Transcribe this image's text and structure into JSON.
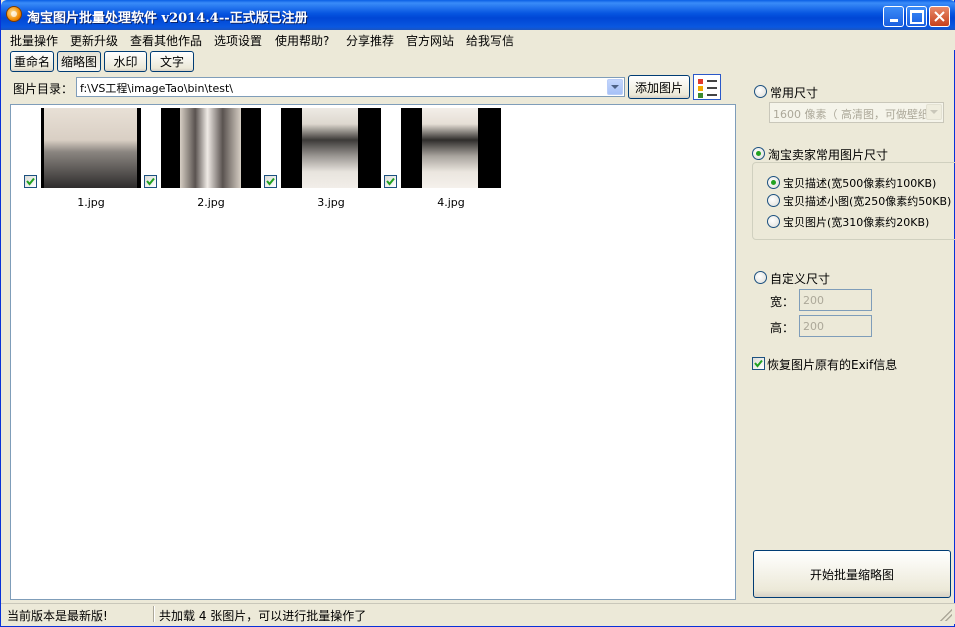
{
  "window": {
    "title": "淘宝图片批量处理软件  v2014.4--正式版已注册"
  },
  "menu": [
    "批量操作",
    "更新升级",
    "查看其他作品",
    "选项设置",
    "使用帮助?",
    "分享推荐",
    "官方网站",
    "给我写信"
  ],
  "toolbar": {
    "tabs": [
      "重命名",
      "缩略图",
      "水印",
      "文字"
    ],
    "active_tab": "缩略图"
  },
  "directory": {
    "label": "图片目录：",
    "path": "f:\\VS工程\\imageTao\\bin\\test\\",
    "add_button": "添加图片"
  },
  "thumbnails": [
    {
      "file": "1.jpg",
      "checked": true
    },
    {
      "file": "2.jpg",
      "checked": true
    },
    {
      "file": "3.jpg",
      "checked": true
    },
    {
      "file": "4.jpg",
      "checked": true
    }
  ],
  "options": {
    "common_size": {
      "label": "常用尺寸",
      "selected": false,
      "dropdown_value": "1600 像素（ 高清图，可做壁纸"
    },
    "taobao_size": {
      "label": "淘宝卖家常用图片尺寸",
      "selected": true,
      "choices": [
        {
          "label": "宝贝描述(宽500像素约100KB)",
          "selected": true
        },
        {
          "label": "宝贝描述小图(宽250像素约50KB)",
          "selected": false
        },
        {
          "label": "宝贝图片(宽310像素约20KB)",
          "selected": false
        }
      ]
    },
    "custom_size": {
      "label": "自定义尺寸",
      "selected": false,
      "width_label": "宽：",
      "width_value": "200",
      "height_label": "高：",
      "height_value": "200"
    },
    "exif": {
      "label": "恢复图片原有的Exif信息",
      "checked": true
    }
  },
  "start_button": "开始批量缩略图",
  "status": {
    "left": "当前版本是最新版!",
    "right": "共加载 4 张图片，可以进行批量操作了"
  },
  "colors": {
    "titlebar": "#0054e3",
    "window_bg": "#ece9d8",
    "check_green": "#21a121"
  }
}
